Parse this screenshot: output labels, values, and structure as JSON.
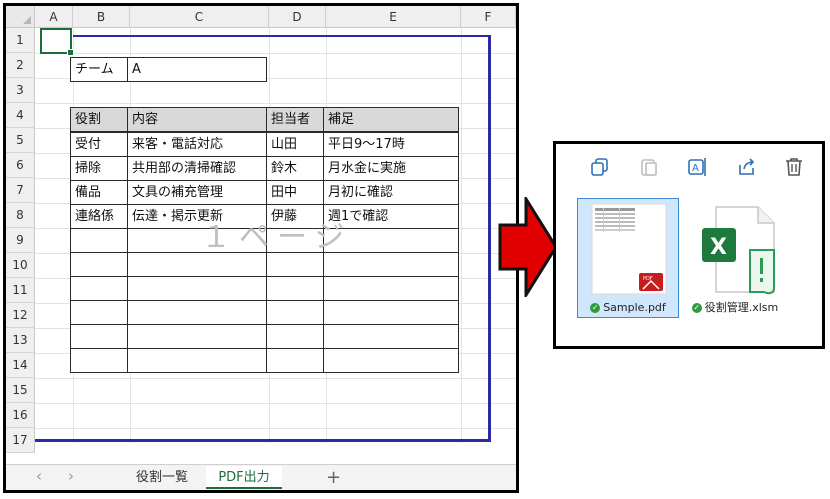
{
  "excel": {
    "columns": [
      "A",
      "B",
      "C",
      "D",
      "E",
      "F"
    ],
    "rows": [
      "1",
      "2",
      "3",
      "4",
      "5",
      "6",
      "7",
      "8",
      "9",
      "10",
      "11",
      "12",
      "13",
      "14",
      "15",
      "16",
      "17"
    ],
    "team_label": "チーム",
    "team_value": "A",
    "table_headers": [
      "役割",
      "内容",
      "担当者",
      "補足"
    ],
    "table_rows": [
      [
        "受付",
        "来客・電話対応",
        "山田",
        "平日9～17時"
      ],
      [
        "掃除",
        "共用部の清掃確認",
        "鈴木",
        "月水金に実施"
      ],
      [
        "備品",
        "文具の補充管理",
        "田中",
        "月初に確認"
      ],
      [
        "連絡係",
        "伝達・掲示更新",
        "伊藤",
        "週1で確認"
      ]
    ],
    "watermark": "１ページ",
    "sheet_tabs": [
      "役割一覧",
      "PDF出力"
    ],
    "active_tab": "PDF出力",
    "add_sheet": "+"
  },
  "explorer": {
    "toolbar_icons": [
      "copy-icon",
      "paste-icon",
      "rename-icon",
      "share-icon",
      "delete-icon"
    ],
    "files": [
      {
        "name": "Sample.pdf",
        "icon": "pdf-file-icon",
        "selected": true
      },
      {
        "name": "役割管理.xlsm",
        "icon": "excel-file-icon",
        "selected": false
      }
    ]
  },
  "colors": {
    "page_break": "#2a2aa8",
    "excel_green": "#1e6b3c",
    "arrow_red": "#e00000",
    "selection": "#cfe6fb"
  }
}
